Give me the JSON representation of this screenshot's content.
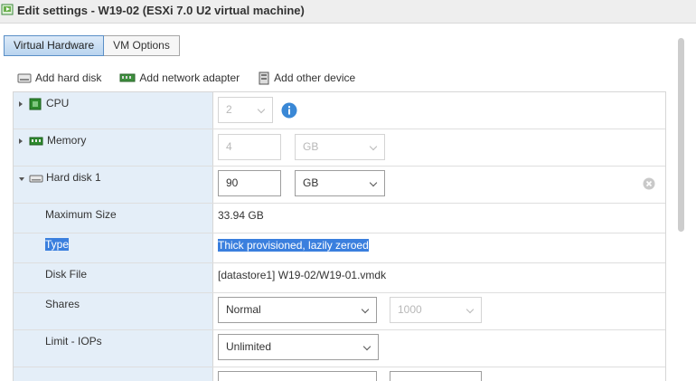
{
  "title": "Edit settings - W19-02 (ESXi 7.0 U2 virtual machine)",
  "tabs": [
    {
      "label": "Virtual Hardware",
      "active": true
    },
    {
      "label": "VM Options",
      "active": false
    }
  ],
  "toolbar": {
    "add_hard_disk": "Add hard disk",
    "add_network_adapter": "Add network adapter",
    "add_other_device": "Add other device"
  },
  "hardware": {
    "cpu": {
      "label": "CPU",
      "value": "2"
    },
    "memory": {
      "label": "Memory",
      "value": "4",
      "unit": "GB"
    },
    "hard_disk": {
      "label": "Hard disk 1",
      "value": "90",
      "unit": "GB"
    }
  },
  "details": {
    "max_size": {
      "label": "Maximum Size",
      "value": "33.94 GB"
    },
    "type": {
      "label": "Type",
      "value": "Thick provisioned, lazily zeroed"
    },
    "disk_file": {
      "label": "Disk File",
      "value": "[datastore1] W19-02/W19-01.vmdk"
    },
    "shares": {
      "label": "Shares",
      "value": "Normal",
      "amount": "1000"
    },
    "limit_iops": {
      "label": "Limit - IOPs",
      "value": "Unlimited"
    }
  },
  "icons": [
    "vm-icon",
    "disk-icon",
    "nic-icon",
    "device-icon",
    "cpu-icon",
    "memory-icon",
    "info-icon",
    "remove-icon"
  ],
  "colors": {
    "accent": "#3a7fde",
    "label_column": "#e4eef8",
    "info": "#3a88d6",
    "cpu_green": "#2e8b2e"
  }
}
